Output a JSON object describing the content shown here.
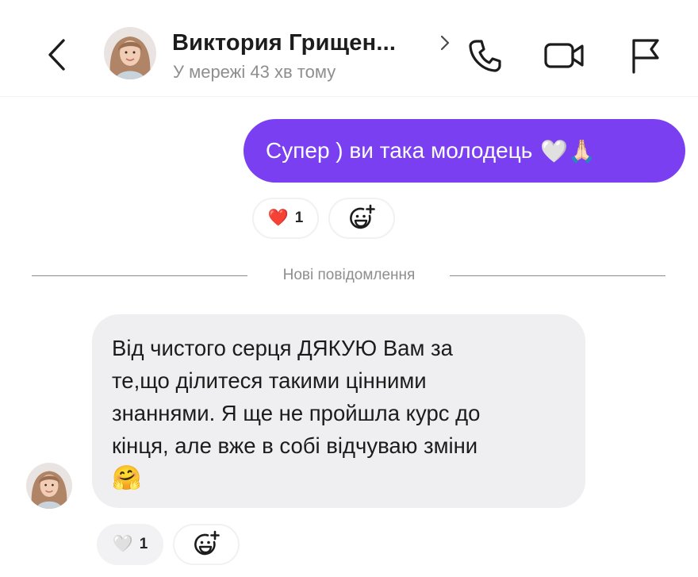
{
  "header": {
    "contact_name": "Виктория Грищен...",
    "status": "У мережі 43 хв тому",
    "icons": [
      "back-chevron-icon",
      "avatar",
      "chevron-right-icon",
      "phone-icon",
      "video-camera-icon",
      "flag-icon"
    ]
  },
  "outgoing_message": {
    "text": "Супер ) ви така молодець",
    "emoji": "🤍🙏🏻",
    "color": "#7b3ff2",
    "reaction": {
      "emoji": "❤️",
      "count": "1"
    }
  },
  "divider": {
    "label": "Нові повідомлення"
  },
  "incoming_message": {
    "lines": [
      "Від чистого серця ДЯКУЮ Вам за",
      "те,що ділитеся такими цінними",
      "знаннями. Я ще не пройшла курс до",
      "кінця, але вже в собі відчуваю зміни"
    ],
    "emoji": "🤗",
    "reaction": {
      "emoji": "🤍",
      "count": "1"
    }
  },
  "colors": {
    "accent": "#7b3ff2",
    "incoming_bubble": "#efeff1",
    "secondary_text": "#8e8e8e"
  }
}
